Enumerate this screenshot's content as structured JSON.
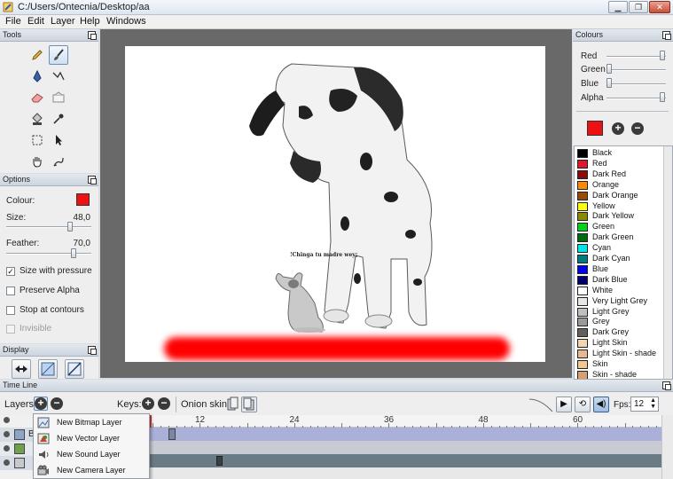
{
  "window": {
    "title": "C:/Users/Ontecnia/Desktop/aa"
  },
  "menu": [
    "File",
    "Edit",
    "Layer",
    "Help",
    "Windows"
  ],
  "panels": {
    "tools_title": "Tools",
    "options_title": "Options",
    "display_title": "Display",
    "colours_title": "Colours",
    "timeline_title": "Time Line"
  },
  "tools": [
    "pencil-icon",
    "brush-icon",
    "pen-icon",
    "polyline-icon",
    "eraser-icon",
    "clear-icon",
    "bucket-icon",
    "eyedropper-icon",
    "select-icon",
    "pointer-icon",
    "hand-icon",
    "smudge-icon"
  ],
  "options": {
    "colour_label": "Colour:",
    "colour_value": "#ee1111",
    "size_label": "Size:",
    "size_value": "48,0",
    "feather_label": "Feather:",
    "feather_value": "70,0",
    "size_pressure_label": "Size with pressure",
    "size_pressure_checked": true,
    "preserve_alpha_label": "Preserve Alpha",
    "preserve_alpha_checked": false,
    "stop_contours_label": "Stop at contours",
    "stop_contours_checked": false,
    "invisible_label": "Invisible",
    "invisible_checked": false
  },
  "colours_panel": {
    "red_label": "Red",
    "green_label": "Green",
    "blue_label": "Blue",
    "alpha_label": "Alpha",
    "current_colour": "#ee1111"
  },
  "colour_list": [
    {
      "name": "Black",
      "hex": "#000000"
    },
    {
      "name": "Red",
      "hex": "#e0182c"
    },
    {
      "name": "Dark Red",
      "hex": "#8a0a0a"
    },
    {
      "name": "Orange",
      "hex": "#ff8a00"
    },
    {
      "name": "Dark Orange",
      "hex": "#9a4a00"
    },
    {
      "name": "Yellow",
      "hex": "#ffff00"
    },
    {
      "name": "Dark Yellow",
      "hex": "#8a8a00"
    },
    {
      "name": "Green",
      "hex": "#00d21e"
    },
    {
      "name": "Dark Green",
      "hex": "#006a10"
    },
    {
      "name": "Cyan",
      "hex": "#00e6e6"
    },
    {
      "name": "Dark Cyan",
      "hex": "#007a7a"
    },
    {
      "name": "Blue",
      "hex": "#0000e6"
    },
    {
      "name": "Dark Blue",
      "hex": "#00006a"
    },
    {
      "name": "White",
      "hex": "#ffffff"
    },
    {
      "name": "Very Light Grey",
      "hex": "#e6e6e6"
    },
    {
      "name": "Light Grey",
      "hex": "#c0c0c0"
    },
    {
      "name": "Grey",
      "hex": "#9a9a9a"
    },
    {
      "name": "Dark Grey",
      "hex": "#606060"
    },
    {
      "name": "Light Skin",
      "hex": "#f5d4b0"
    },
    {
      "name": "Light Skin - shade",
      "hex": "#e8b890"
    },
    {
      "name": "Skin",
      "hex": "#f0c890"
    },
    {
      "name": "Skin - shade",
      "hex": "#d8a070"
    }
  ],
  "canvas": {
    "caption": "!Chinga tu madre wey¡",
    "stroke_colour": "#ff0000"
  },
  "timeline": {
    "layers_label": "Layers:",
    "keys_label": "Keys:",
    "onion_label": "Onion skin:",
    "fps_label": "Fps:",
    "fps_value": "12",
    "ruler_ticks": [
      "12",
      "24",
      "36",
      "48",
      "60"
    ],
    "layer_visible_rows": [
      "B",
      "",
      ""
    ]
  },
  "layer_menu": [
    "New Bitmap Layer",
    "New Vector Layer",
    "New Sound Layer",
    "New Camera Layer"
  ]
}
